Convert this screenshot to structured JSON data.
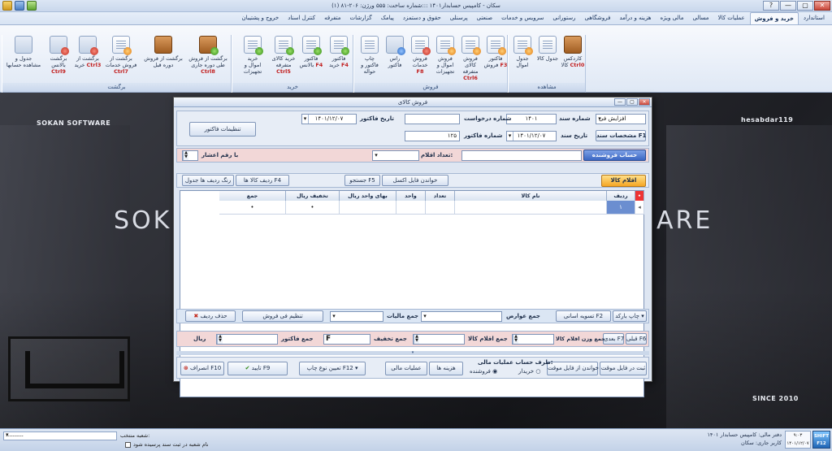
{
  "window": {
    "title": "سکان - کامپیس حسابدار۱۴۰۱ :::شماره ساخت: ۵۵۵  ورژن: ۲۰۶-۸۱ (۱)",
    "controls": [
      "?",
      "—",
      "▢",
      "✕"
    ]
  },
  "ribbon_tabs": [
    {
      "label": "استاندارد",
      "active": false
    },
    {
      "label": "خرید و فروش",
      "active": true
    },
    {
      "label": "عملیات کالا",
      "active": false
    },
    {
      "label": "مسالی",
      "active": false
    },
    {
      "label": "مالی ویژه",
      "active": false
    },
    {
      "label": "هزینه و درآمد",
      "active": false
    },
    {
      "label": "فروشگاهی",
      "active": false
    },
    {
      "label": "رستورانی",
      "active": false
    },
    {
      "label": "سرویس و خدمات",
      "active": false
    },
    {
      "label": "صنعتی",
      "active": false
    },
    {
      "label": "پرسنلی",
      "active": false
    },
    {
      "label": "حقوق و دستمزد",
      "active": false
    },
    {
      "label": "پیامک",
      "active": false
    },
    {
      "label": "گزارشات",
      "active": false
    },
    {
      "label": "متفرقه",
      "active": false
    },
    {
      "label": "کنترل اسناد",
      "active": false
    },
    {
      "label": "خروج و پشتیبان",
      "active": false
    }
  ],
  "ribbon_groups": {
    "view": {
      "label": "مشاهده",
      "buttons": [
        {
          "label": "کاردکس کالا",
          "key": "Ctrl0"
        },
        {
          "label": "جدول کالا",
          "key": ""
        },
        {
          "label": "جدول اموال",
          "key": ""
        }
      ]
    },
    "sales": {
      "label": "فروش",
      "buttons": [
        {
          "label": "فاکتور فروش",
          "key": "F3"
        },
        {
          "label": "فروش کالای متفرقه",
          "key": "Ctrl6"
        },
        {
          "label": "فروش اموال و تجهیزات",
          "key": ""
        },
        {
          "label": "فروش خدمات",
          "key": "F8"
        },
        {
          "label": "راس فاکتور",
          "key": ""
        },
        {
          "label": "چاپ فاکتور و حواله",
          "key": ""
        }
      ]
    },
    "purchase": {
      "label": "خرید",
      "buttons": [
        {
          "label": "فاکتور خرید",
          "key": "F4"
        },
        {
          "label": "فاکتور بالانس",
          "key": "F4"
        },
        {
          "label": "خرید کالای متفرقه",
          "key": "Ctrl5"
        },
        {
          "label": "خرید اموال و تجهیزات",
          "key": ""
        }
      ]
    },
    "returns": {
      "label": "برگشت",
      "buttons": [
        {
          "label": "برگشت از فروش طی دوره جاری",
          "key": "Ctrl8"
        },
        {
          "label": "برگشت از فروش دوره قبل",
          "key": ""
        },
        {
          "label": "برگشت از فروش خدمات",
          "key": "Ctrl7"
        },
        {
          "label": "برگشت از خرید",
          "key": "Ctrl3"
        },
        {
          "label": "برگشت بالانس",
          "key": "Ctrl9"
        },
        {
          "label": "جدول و مشاهده حسابها",
          "key": ""
        }
      ]
    }
  },
  "background": {
    "brand_left": "SOKAN SOFTWARE",
    "brand_right": "hesabdar119",
    "big_left": "SOK",
    "big_right": "ARE",
    "since": "SINCE 2010"
  },
  "dialog": {
    "title": "فروش کالای",
    "doc_type_label": "افزایش فی",
    "doc_no_label": "شماره سند",
    "doc_no_value": "۱۴۰۱",
    "doc_date_label": "تاریخ سند",
    "doc_date_value": "۱۴۰۱/۱۲/۰۷",
    "request_no_label": "شماره درخواست",
    "request_no_value": "",
    "invoice_no_label": "شماره فاکتور",
    "invoice_no_value": "۱۲۵",
    "invoice_date_label": "تاریخ فاکتور",
    "invoice_date_value": "۱۴۰۱/۱۲/۰۷",
    "doc_specs_btn": "مشخصات سند F1",
    "invoice_settings_btn": "تنظیمات فاکتور",
    "seller_account_btn": "حساب فروشنده",
    "items_count_label": "تعداد اقلام:",
    "decimal_label": "با رقم اعشار",
    "items_tab": "اقلام کالا",
    "read_excel_btn": "خواندن فایل اکسل",
    "search_btn": "جستجو F5",
    "item_rows_btn": "ردیف کالا ها F4",
    "table_rows_color_btn": "رنگ ردیف ها جدول",
    "table": {
      "columns": [
        "ردیف",
        "نام کالا",
        "تعداد",
        "واحد",
        "بهای واحد ریال",
        "تخفیف ریال",
        "جمع"
      ],
      "rows": [
        {
          "row": "۱",
          "name": "",
          "qty": "",
          "unit": "",
          "unit_price": "",
          "discount": "•",
          "total": "•"
        }
      ]
    },
    "print_barcode_btn": "چاپ بارکد",
    "settle_btn": "تسویه اسانی F2",
    "charges_label": "جمع عوارض",
    "tax_label": "جمع مالیات",
    "adjust_sale_btn": "تنظیم فی فروش",
    "delete_row_btn": "حذف ردیف",
    "prev_btn": "قبلی F6",
    "next_btn": "بعدی F7",
    "weight_label": "جمع وزن اقلام کالا",
    "items_total_label": "جمع اقلام کالا",
    "discount_total_label": "جمع تخفیف",
    "invoice_total_label": "جمع فاکتور",
    "rial_label": "ریال",
    "save_temp_btn": "ثبت در فایل موقت",
    "read_temp_btn": "خواندن از فایل موقت",
    "financial_side_label": "طرف حساب عملیات مالی:",
    "radio_buyer": "خریدار",
    "radio_seller": "فروشنده",
    "cost_btn": "هزینه ها",
    "financial_ops_btn": "عملیات مالی",
    "print_type_btn": "تعیین نوع چاپ F12",
    "confirm_btn": "تایید F9",
    "cancel_btn": "انصراف F10"
  },
  "statusbar": {
    "company": "دفتر مالی: کامپیس حسابدار ۱۴۰۱",
    "user": "کاربر جاری: سکان",
    "date": "۱۴۰۱/۱۲/۰۷",
    "time": "۹:۰۳",
    "avatar_text": "SHIFT F12",
    "branch_label": "شعبه منتخب:",
    "branch_value": "----------",
    "checkbox_label": "نام شعبه در ثبت سند پرسیده شود"
  },
  "colors": {
    "accent": "#1f65b5",
    "highlight_row": "#6b8ed0",
    "tab_orange": "#f5a623",
    "account_btn": "#3b67c2"
  }
}
